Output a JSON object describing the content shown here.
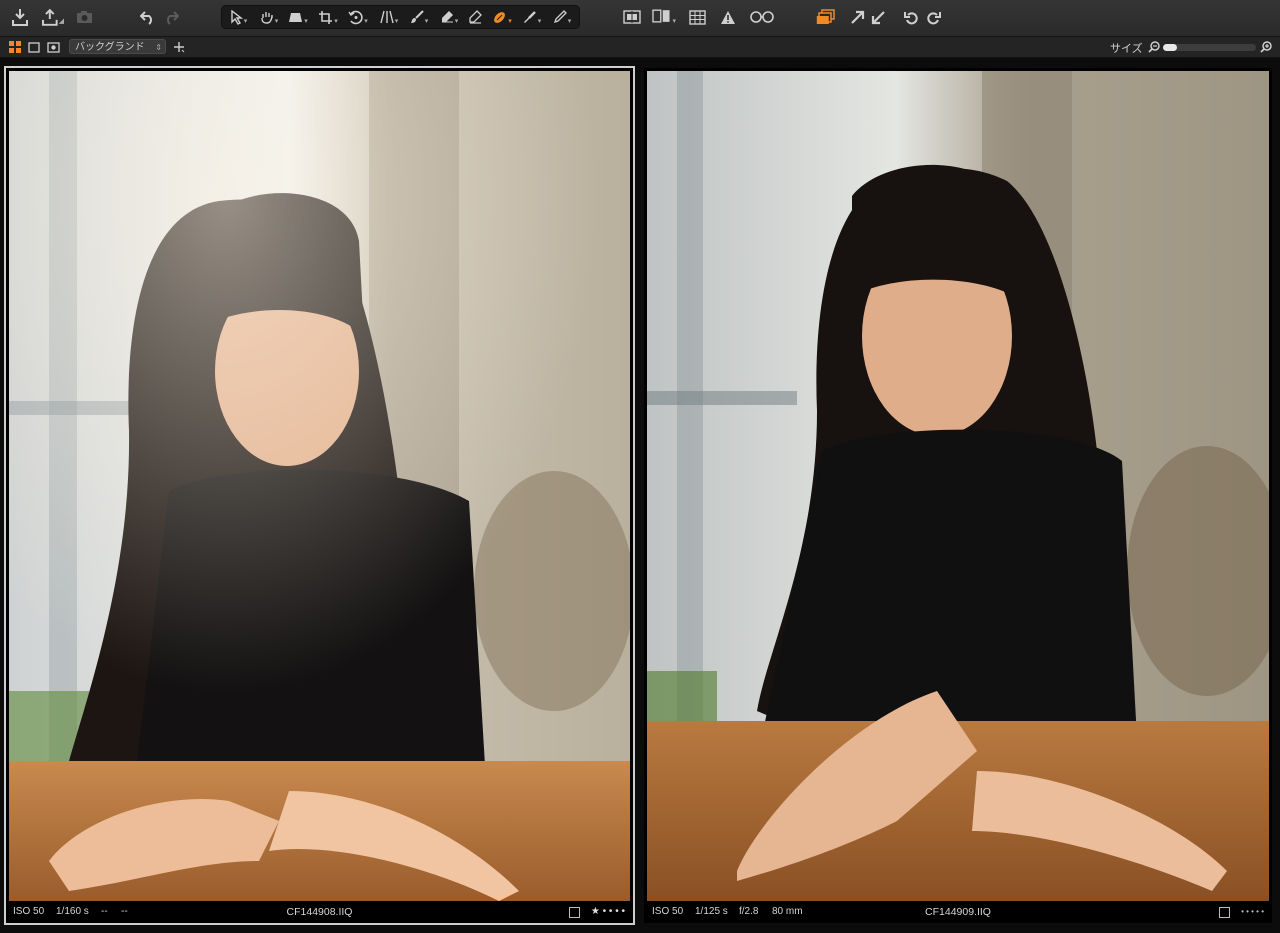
{
  "toolbar": {
    "left_icons": [
      "import-icon",
      "export-icon",
      "camera-icon",
      "undo-icon",
      "redo-icon"
    ],
    "tool_icons": [
      "cursor-tool-icon",
      "pan-tool-icon",
      "straighten-tool-icon",
      "crop-tool-icon",
      "rotate-tool-icon",
      "keystone-tool-icon",
      "brush-tool-icon",
      "eraser-tool-icon",
      "gradient-tool-icon",
      "healing-tool-icon",
      "color-picker-icon",
      "annotate-tool-icon"
    ],
    "active_tool": "healing-tool-icon",
    "right_icons": [
      "overlay-icon",
      "compare-icon",
      "grid-icon",
      "exposure-warning-icon",
      "proof-glasses-icon",
      "multi-view-icon",
      "expand-icon",
      "collapse-icon",
      "rotate-left-icon",
      "rotate-right-icon"
    ],
    "accent_color": "#f08a24"
  },
  "subbar": {
    "background_label": "バックグランド",
    "size_label": "サイズ",
    "zoom_percent": 6
  },
  "viewer": {
    "images": [
      {
        "iso": "ISO 50",
        "shutter": "1/160 s",
        "aperture": "--",
        "focal": "--",
        "filename": "CF144908.IIQ",
        "stars": "★ • • • •",
        "selected": true
      },
      {
        "iso": "ISO 50",
        "shutter": "1/125 s",
        "aperture": "f/2.8",
        "focal": "80 mm",
        "filename": "CF144909.IIQ",
        "stars": "• • • • •",
        "selected": false
      }
    ]
  }
}
